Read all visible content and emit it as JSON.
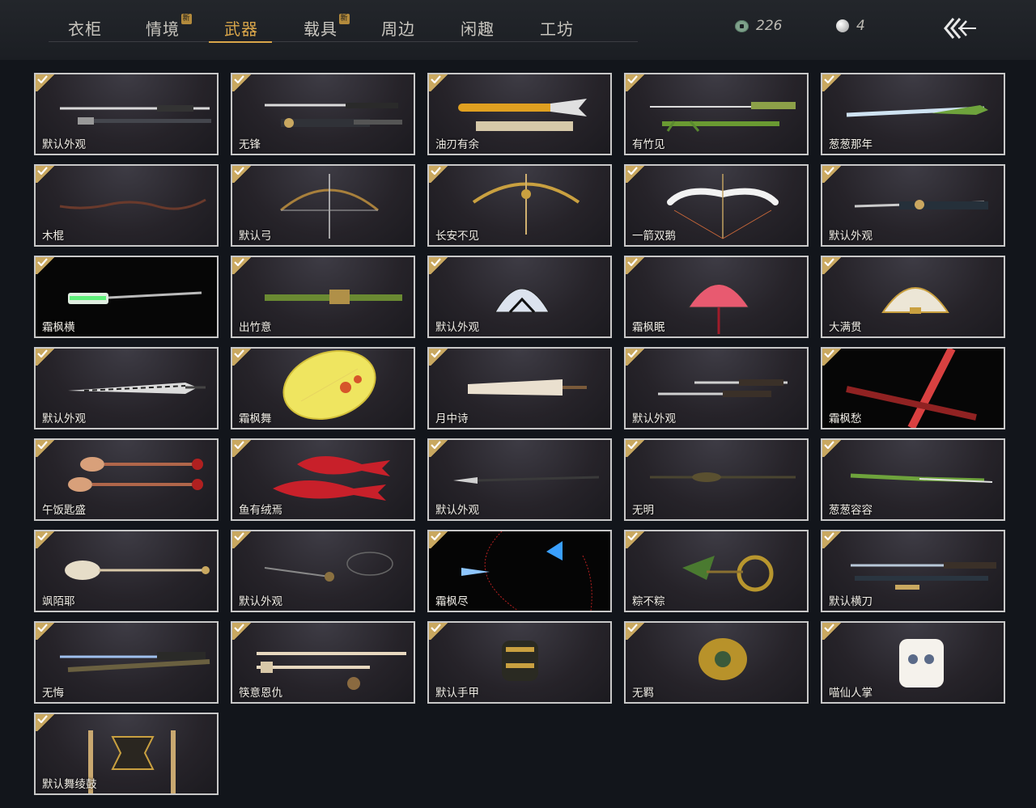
{
  "tabs": [
    {
      "label": "衣柜",
      "new": false,
      "active": false
    },
    {
      "label": "情境",
      "new": true,
      "active": false
    },
    {
      "label": "武器",
      "new": false,
      "active": true
    },
    {
      "label": "载具",
      "new": true,
      "active": false
    },
    {
      "label": "周边",
      "new": false,
      "active": false
    },
    {
      "label": "闲趣",
      "new": false,
      "active": false
    },
    {
      "label": "工坊",
      "new": false,
      "active": false
    }
  ],
  "new_badge": "新",
  "currency": {
    "jade": "226",
    "pearl": "4"
  },
  "colors": {
    "accent": "#d9a64a",
    "check": "#c9a860",
    "card_border": "#c8c8c8"
  },
  "items": [
    {
      "name": "默认外观",
      "art": "sword-pair",
      "owned": true
    },
    {
      "name": "无锋",
      "art": "sword-pair-ornate",
      "owned": true
    },
    {
      "name": "油刃有余",
      "art": "fish-blade",
      "owned": true
    },
    {
      "name": "有竹见",
      "art": "bamboo-sword",
      "owned": true
    },
    {
      "name": "葱葱那年",
      "art": "scallion-blade",
      "owned": true
    },
    {
      "name": "木棍",
      "art": "wood-stick",
      "owned": true
    },
    {
      "name": "默认弓",
      "art": "bow",
      "owned": true
    },
    {
      "name": "长安不见",
      "art": "golden-bow",
      "owned": true
    },
    {
      "name": "一箭双鹅",
      "art": "goose-bow",
      "owned": true
    },
    {
      "name": "默认外观",
      "art": "ornate-blade",
      "owned": true
    },
    {
      "name": "霜枫横",
      "art": "neon-blade",
      "owned": true
    },
    {
      "name": "出竹意",
      "art": "bamboo-staff",
      "owned": true
    },
    {
      "name": "默认外观",
      "art": "fan-white",
      "owned": true
    },
    {
      "name": "霜枫眠",
      "art": "fan-red",
      "owned": true
    },
    {
      "name": "大满贯",
      "art": "fan-gold",
      "owned": true
    },
    {
      "name": "默认外观",
      "art": "umbrella-closed-striped",
      "owned": true
    },
    {
      "name": "霜枫舞",
      "art": "umbrella-yellow",
      "owned": true
    },
    {
      "name": "月中诗",
      "art": "umbrella-closed-paper",
      "owned": true
    },
    {
      "name": "默认外观",
      "art": "twin-blades",
      "owned": true
    },
    {
      "name": "霜枫愁",
      "art": "red-sword",
      "owned": true
    },
    {
      "name": "午饭匙盛",
      "art": "spoons",
      "owned": true
    },
    {
      "name": "鱼有绒焉",
      "art": "red-fish",
      "owned": true
    },
    {
      "name": "默认外观",
      "art": "spear",
      "owned": true
    },
    {
      "name": "无明",
      "art": "dark-spear",
      "owned": true
    },
    {
      "name": "葱葱容容",
      "art": "scallion-spear",
      "owned": true
    },
    {
      "name": "飒陌耶",
      "art": "spoon-staff",
      "owned": true
    },
    {
      "name": "默认外观",
      "art": "rope-dart",
      "owned": true
    },
    {
      "name": "霜枫尽",
      "art": "glow-dart",
      "owned": true
    },
    {
      "name": "粽不粽",
      "art": "zongzi-dart",
      "owned": true
    },
    {
      "name": "默认横刀",
      "art": "long-blade",
      "owned": true
    },
    {
      "name": "无悔",
      "art": "blue-blade",
      "owned": true
    },
    {
      "name": "筷意恩仇",
      "art": "chopsticks",
      "owned": true
    },
    {
      "name": "默认手甲",
      "art": "gauntlet",
      "owned": true
    },
    {
      "name": "无羁",
      "art": "gold-gauntlet",
      "owned": true
    },
    {
      "name": "喵仙人掌",
      "art": "cat-paw",
      "owned": true
    },
    {
      "name": "默认舞绫鼓",
      "art": "drum",
      "owned": true
    }
  ]
}
